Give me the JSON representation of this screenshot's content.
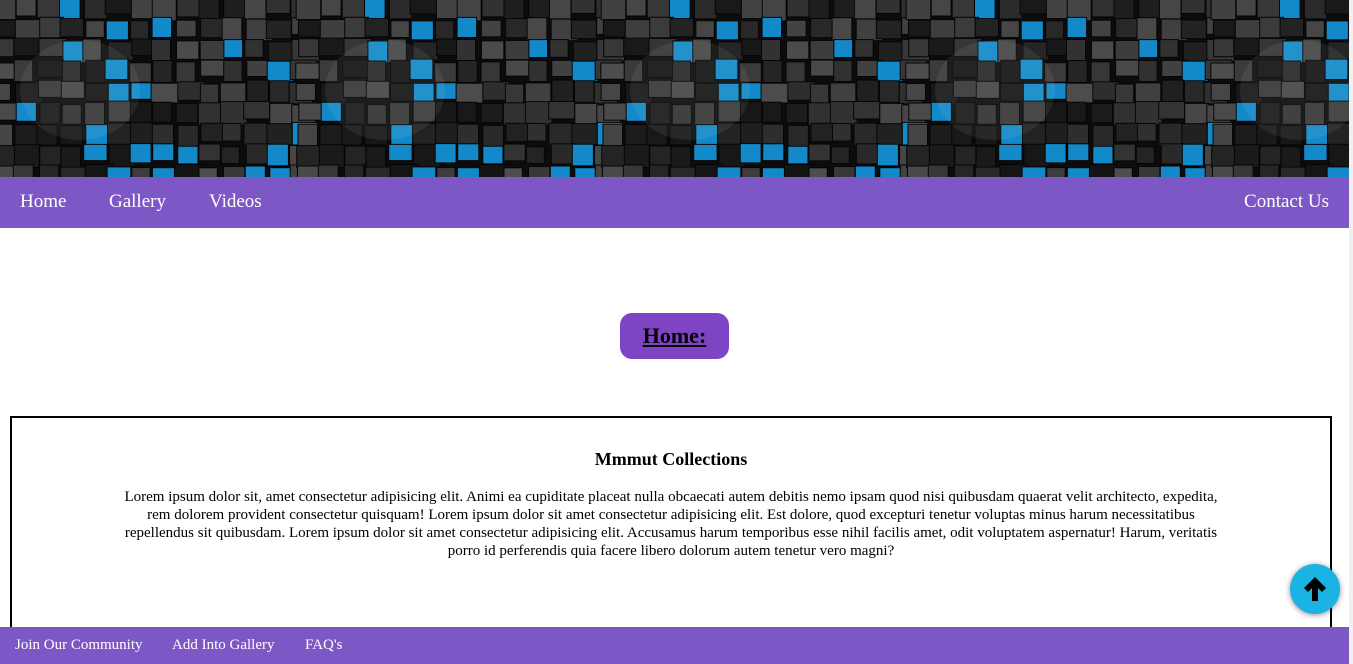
{
  "colors": {
    "nav_bg": "#7e57c7",
    "badge_bg": "#7f44c4",
    "scroll_top_bg": "#1ab3e3",
    "banner_accent": "#1389c9"
  },
  "banner": {
    "image": "dark-blue-cubes-pattern"
  },
  "nav": {
    "home": "Home",
    "gallery": "Gallery",
    "videos": "Videos",
    "contact": "Contact Us"
  },
  "main": {
    "badge": "Home:",
    "card": {
      "title": "Mmmut Collections",
      "body": "Lorem ipsum dolor sit, amet consectetur adipisicing elit. Animi ea cupiditate placeat nulla obcaecati autem debitis nemo ipsam quod nisi quibusdam quaerat velit architecto, expedita, rem dolorem provident consectetur quisquam! Lorem ipsum dolor sit amet consectetur adipisicing elit. Est dolore, quod excepturi tenetur voluptas minus harum necessitatibus repellendus sit quibusdam. Lorem ipsum dolor sit amet consectetur adipisicing elit. Accusamus harum temporibus esse nihil facilis amet, odit voluptatem aspernatur! Harum, veritatis porro id perferendis quia facere libero dolorum autem tenetur vero magni?"
    }
  },
  "footer": {
    "join": "Join Our Community",
    "add": "Add Into Gallery",
    "faq": "FAQ's"
  },
  "scroll_top": {
    "icon": "arrow-up-icon"
  }
}
